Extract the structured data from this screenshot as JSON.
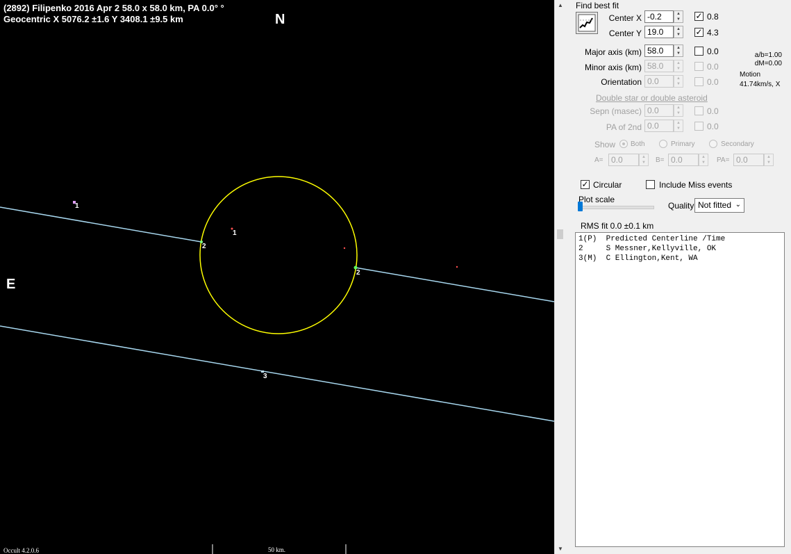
{
  "plot": {
    "title": "(2892) Filipenko  2016 Apr 2   58.0 x 58.0 km, PA 0.0° °",
    "geocentric": "Geocentric  X  5076.2 ±1.6  Y 3408.1 ±9.5 km",
    "north": "N",
    "east": "E",
    "version": "Occult 4.2.0.6",
    "scale": "50 km.",
    "chord_labels": [
      "1",
      "1",
      "2",
      "2",
      "3"
    ]
  },
  "panel": {
    "find_best_fit": "Find best fit",
    "center_x": {
      "label": "Center X",
      "value": "-0.2",
      "check_value": "0.8",
      "checked": true
    },
    "center_y": {
      "label": "Center Y",
      "value": "19.0",
      "check_value": "4.3",
      "checked": true
    },
    "major_axis": {
      "label": "Major axis (km)",
      "value": "58.0",
      "check_value": "0.0",
      "checked": false
    },
    "minor_axis": {
      "label": "Minor axis (km)",
      "value": "58.0",
      "check_value": "0.0"
    },
    "orientation": {
      "label": "Orientation",
      "value": "0.0",
      "check_value": "0.0"
    },
    "ab_ratio": "a/b=1.00",
    "dm": "dM=0.00",
    "motion_label": "Motion",
    "motion_value": "41.74km/s, X",
    "double_star": "Double star  or  double asteroid",
    "sepn": {
      "label": "Sepn (masec)",
      "value": "0.0",
      "check_value": "0.0"
    },
    "pa2": {
      "label": "PA of 2nd",
      "value": "0.0",
      "check_value": "0.0"
    },
    "show_label": "Show",
    "show_options": [
      "Both",
      "Primary",
      "Secondary"
    ],
    "a_label": "A=",
    "a_value": "0.0",
    "b_label": "B=",
    "b_value": "0.0",
    "pa_label": "PA=",
    "pa_value": "0.0",
    "circular_label": "Circular",
    "circular_checked": true,
    "include_miss_label": "Include Miss events",
    "include_miss_checked": false,
    "plot_scale": "Plot scale",
    "quality_label": "Quality",
    "quality_value": "Not fitted",
    "rms_fit": "RMS fit 0.0 ±0.1 km",
    "observers": [
      "1(P)  Predicted Centerline /Time",
      "2     S Messner,Kellyville, OK",
      "3(M)  C Ellington,Kent, WA"
    ]
  },
  "colors": {
    "plot_bg": "#000000",
    "ellipse": "#ffff00",
    "chord": "#a8d8f0",
    "panel_bg": "#f0f0f0"
  }
}
